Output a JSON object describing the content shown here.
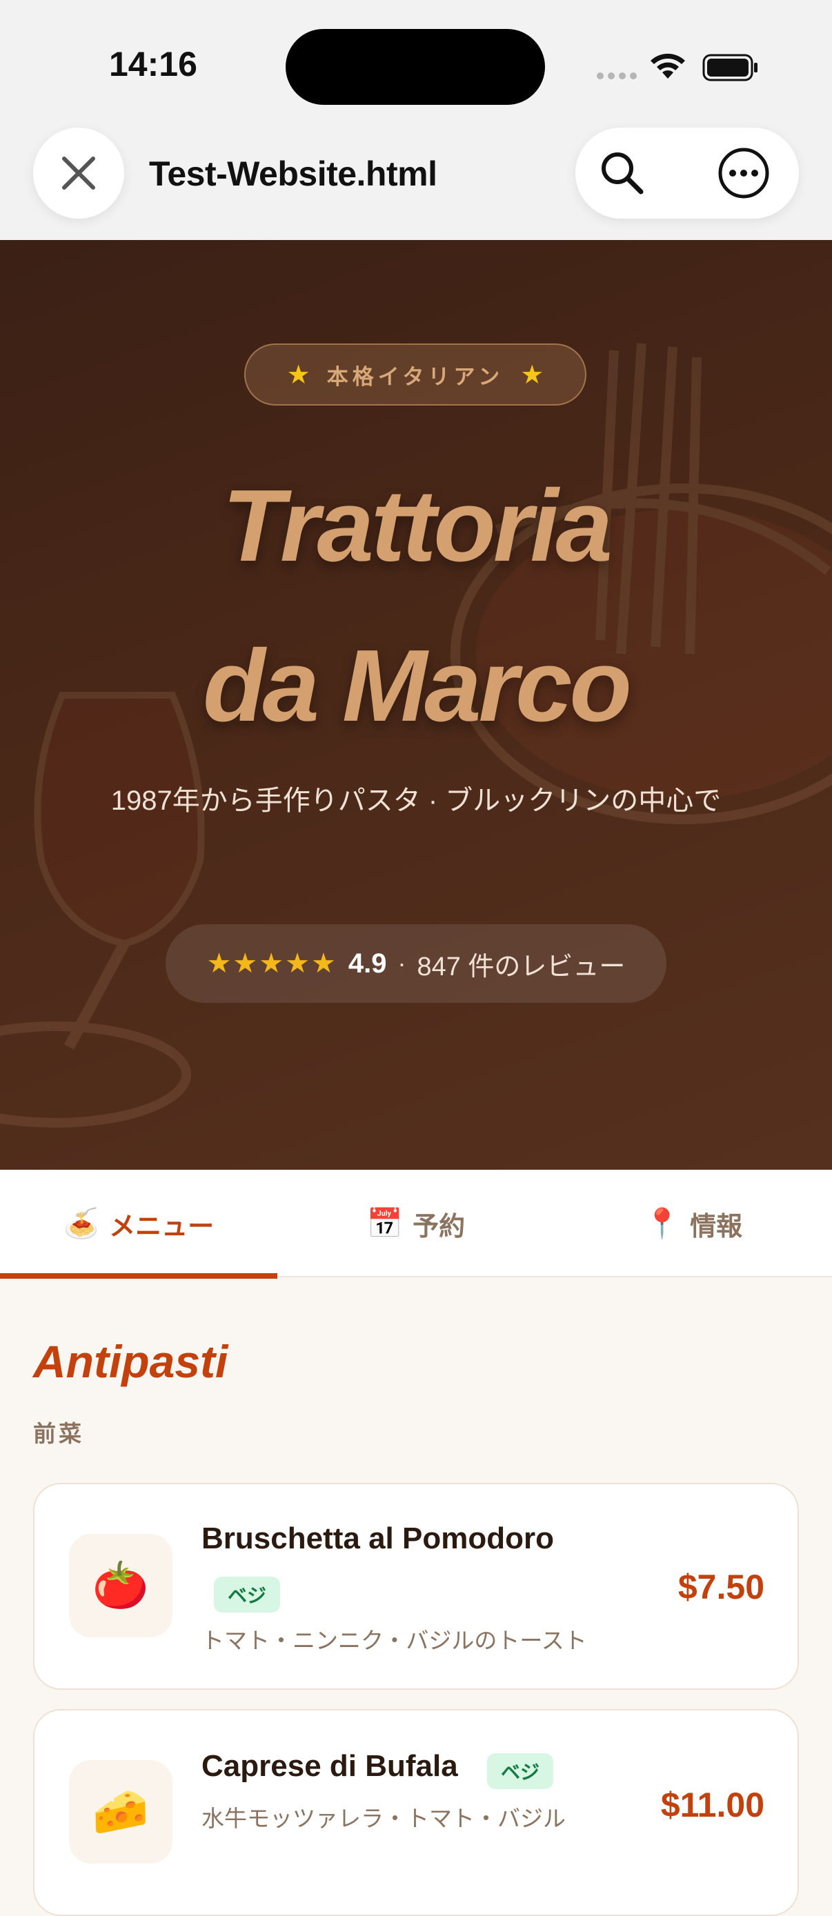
{
  "status_bar": {
    "time": "14:16"
  },
  "browser": {
    "title": "Test-Website.html"
  },
  "hero": {
    "badge_text": "本格イタリアン",
    "title_line1": "Trattoria",
    "title_line2": "da Marco",
    "subtitle": "1987年から手作りパスタ · ブルックリンの中心で",
    "rating_stars": "★★★★★",
    "rating_score": "4.9",
    "rating_separator": "·",
    "rating_count": "847 件のレビュー"
  },
  "tabs": [
    {
      "icon": "🍝",
      "label": "メニュー",
      "active": true
    },
    {
      "icon": "📅",
      "label": "予約",
      "active": false
    },
    {
      "icon": "📍",
      "label": "情報",
      "active": false
    }
  ],
  "menu": {
    "section_title": "Antipasti",
    "section_subtitle": "前菜",
    "items": [
      {
        "icon": "🍅",
        "name": "Bruschetta al Pomodoro",
        "badge": "ベジ",
        "description": "トマト・ニンニク・バジルのトースト",
        "price": "$7.50"
      },
      {
        "icon": "🧀",
        "name": "Caprese di Bufala",
        "badge": "ベジ",
        "description": "水牛モッツァレラ・トマト・バジル",
        "price": "$11.00"
      }
    ]
  },
  "colors": {
    "accent": "#c2410c",
    "hero_title": "#d4a070",
    "hero_bg": "#4a2818",
    "veg_badge_bg": "#d7f6e3",
    "veg_badge_text": "#157a43"
  }
}
